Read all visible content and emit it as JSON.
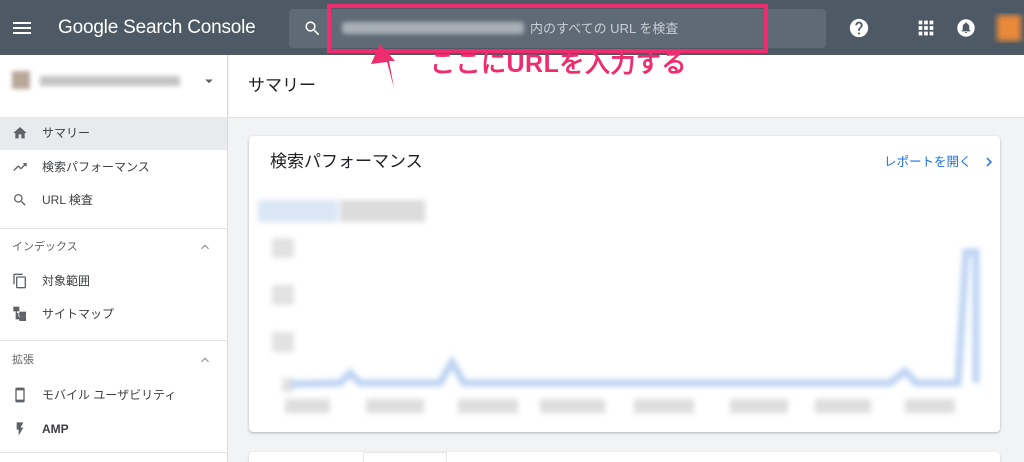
{
  "app": {
    "product_name": "Google Search Console"
  },
  "topbar": {
    "search": {
      "placeholder_suffix": "内のすべての URL を検査",
      "icon": "search-icon"
    },
    "icons": {
      "menu": "menu-icon",
      "help": "help-icon",
      "apps": "apps-icon",
      "notifications": "notifications-icon"
    }
  },
  "annotation": {
    "callout": "ここにURLを入力する"
  },
  "sidebar": {
    "items": [
      {
        "label": "サマリー",
        "icon": "home-icon",
        "selected": true
      },
      {
        "label": "検索パフォーマンス",
        "icon": "trending-up-icon",
        "selected": false
      },
      {
        "label": "URL 検査",
        "icon": "search-icon",
        "selected": false
      }
    ],
    "sections": [
      {
        "title": "インデックス",
        "expanded": true,
        "items": [
          {
            "label": "対象範囲",
            "icon": "copy-icon"
          },
          {
            "label": "サイトマップ",
            "icon": "sitemap-icon"
          }
        ]
      },
      {
        "title": "拡張",
        "expanded": true,
        "items": [
          {
            "label": "モバイル ユーザビリティ",
            "icon": "smartphone-icon"
          },
          {
            "label": "AMP",
            "icon": "flash-icon"
          }
        ]
      }
    ]
  },
  "main": {
    "page_title": "サマリー",
    "performance_card": {
      "title": "検索パフォーマンス",
      "open_report_link": "レポートを開く"
    }
  },
  "colors": {
    "topbar": "#4d5a65",
    "annotation": "#ee2d6e",
    "link": "#1a73e8",
    "selected_item": "#e8eaed",
    "page_background": "#f1f3f4"
  }
}
